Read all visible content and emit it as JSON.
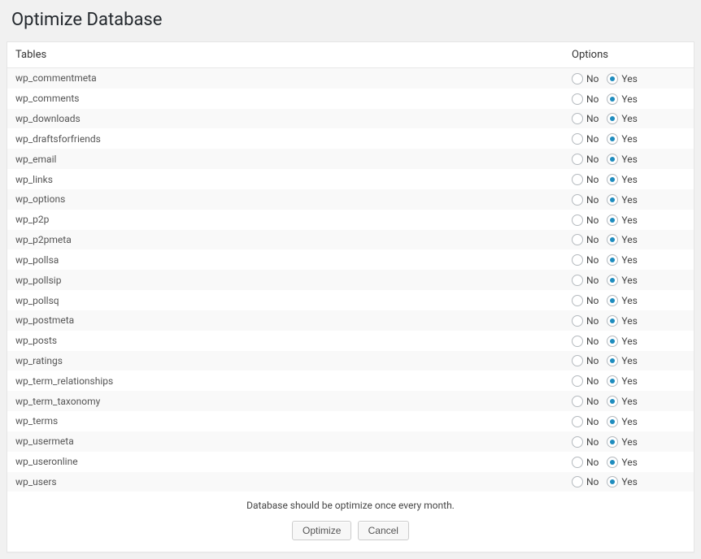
{
  "page_title": "Optimize Database",
  "columns": {
    "tables": "Tables",
    "options": "Options"
  },
  "option_labels": {
    "no": "No",
    "yes": "Yes"
  },
  "rows": [
    {
      "name": "wp_commentmeta",
      "selected": "yes"
    },
    {
      "name": "wp_comments",
      "selected": "yes"
    },
    {
      "name": "wp_downloads",
      "selected": "yes"
    },
    {
      "name": "wp_draftsforfriends",
      "selected": "yes"
    },
    {
      "name": "wp_email",
      "selected": "yes"
    },
    {
      "name": "wp_links",
      "selected": "yes"
    },
    {
      "name": "wp_options",
      "selected": "yes"
    },
    {
      "name": "wp_p2p",
      "selected": "yes"
    },
    {
      "name": "wp_p2pmeta",
      "selected": "yes"
    },
    {
      "name": "wp_pollsa",
      "selected": "yes"
    },
    {
      "name": "wp_pollsip",
      "selected": "yes"
    },
    {
      "name": "wp_pollsq",
      "selected": "yes"
    },
    {
      "name": "wp_postmeta",
      "selected": "yes"
    },
    {
      "name": "wp_posts",
      "selected": "yes"
    },
    {
      "name": "wp_ratings",
      "selected": "yes"
    },
    {
      "name": "wp_term_relationships",
      "selected": "yes"
    },
    {
      "name": "wp_term_taxonomy",
      "selected": "yes"
    },
    {
      "name": "wp_terms",
      "selected": "yes"
    },
    {
      "name": "wp_usermeta",
      "selected": "yes"
    },
    {
      "name": "wp_useronline",
      "selected": "yes"
    },
    {
      "name": "wp_users",
      "selected": "yes"
    }
  ],
  "footer_note": "Database should be optimize once every month.",
  "buttons": {
    "optimize": "Optimize",
    "cancel": "Cancel"
  }
}
